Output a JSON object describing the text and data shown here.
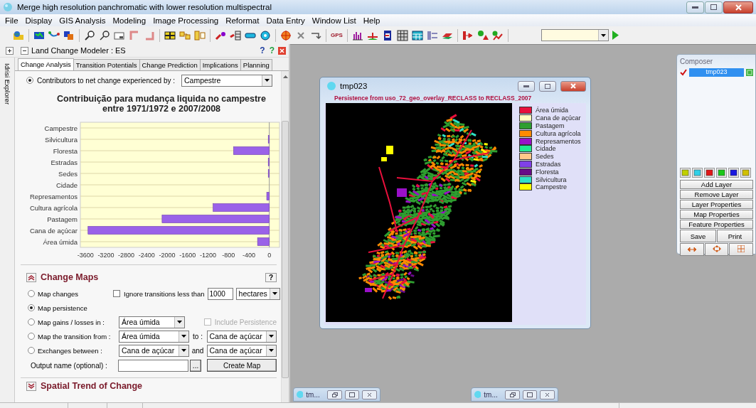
{
  "window": {
    "title": "Merge high resolution panchromatic with lower resolution multispectral"
  },
  "menu": [
    "File",
    "Display",
    "GIS Analysis",
    "Modeling",
    "Image Processing",
    "Reformat",
    "Data Entry",
    "Window List",
    "Help"
  ],
  "toolbar": {
    "gps_label": "GPS"
  },
  "lcm_panel": {
    "title": "Land Change Modeler : ES",
    "help_buttons": [
      "?",
      "?"
    ],
    "explorer_tab": "Idrisi Explorer",
    "tabs": [
      {
        "label": "Change Analysis",
        "selected": true
      },
      {
        "label": "Transition Potentials",
        "selected": false
      },
      {
        "label": "Change Prediction",
        "selected": false
      },
      {
        "label": "Implications",
        "selected": false
      },
      {
        "label": "Planning",
        "selected": false
      }
    ],
    "contributors": {
      "label": "Contributors to net change experienced by :",
      "selected": true,
      "value": "Campestre"
    },
    "chart_data": {
      "type": "bar",
      "orientation": "horizontal",
      "title": "Contribuição para mudança liquida no campestre\nentre 1971/1972 e 2007/2008",
      "categories": [
        "Campestre",
        "Silvicultura",
        "Floresta",
        "Estradas",
        "Sedes",
        "Cidade",
        "Represamentos",
        "Cultura agrícola",
        "Pastagem",
        "Cana de açúcar",
        "Área úmida"
      ],
      "values": [
        0,
        -20,
        -700,
        -20,
        -20,
        0,
        -50,
        -1100,
        -2100,
        -3550,
        -230
      ],
      "xlim": [
        -3700,
        200
      ],
      "xticks": [
        -3600,
        -3200,
        -2800,
        -2400,
        -2000,
        -1600,
        -1200,
        -800,
        -400,
        0
      ]
    },
    "change_maps": {
      "title": "Change Maps",
      "expanded": true,
      "help": "?",
      "options": [
        {
          "kind": "threshold",
          "label": "Map changes",
          "selected": false,
          "checkbox": {
            "label": "Ignore transitions less than",
            "checked": false,
            "disabled": false
          },
          "value": "1000",
          "units": "hectares"
        },
        {
          "kind": "plain",
          "label": "Map persistence",
          "selected": true
        },
        {
          "kind": "gains",
          "label": "Map gains / losses in :",
          "selected": false,
          "value": "Área úmida",
          "checkbox": {
            "label": "Include Persistence",
            "checked": false,
            "disabled": true
          }
        },
        {
          "kind": "pair",
          "label": "Map the transition from :",
          "selected": false,
          "value": "Área úmida",
          "joiner": "to :",
          "value2": "Cana de açúcar"
        },
        {
          "kind": "pair",
          "label": "Exchanges between :",
          "selected": false,
          "value": "Cana de açúcar",
          "joiner": "and",
          "value2": "Cana de açúcar"
        }
      ],
      "output": {
        "label": "Output name (optional) :",
        "browse": "...",
        "button": "Create Map"
      }
    },
    "spatial_trend": {
      "title": "Spatial Trend of Change",
      "expanded": false
    }
  },
  "map_window": {
    "title": "tmp023",
    "subtitle": "Persistence from uso_72_geo_overlay_RECLASS to RECLASS_2007",
    "legend": [
      {
        "label": "Área úmida",
        "color": "#e8103c"
      },
      {
        "label": "Cana de açúcar",
        "color": "#ffffc0"
      },
      {
        "label": "Pastagem",
        "color": "#2e9e30"
      },
      {
        "label": "Cultura agrícola",
        "color": "#ff8a00"
      },
      {
        "label": "Represamentos",
        "color": "#9a10c8"
      },
      {
        "label": "Cidade",
        "color": "#20e890"
      },
      {
        "label": "Sedes",
        "color": "#ffc88a"
      },
      {
        "label": "Estradas",
        "color": "#8040e8"
      },
      {
        "label": "Floresta",
        "color": "#680a88"
      },
      {
        "label": "Silvicultura",
        "color": "#30e0c8"
      },
      {
        "label": "Campestre",
        "color": "#ffff00"
      }
    ]
  },
  "composer": {
    "title": "Composer",
    "layers": [
      {
        "name": "tmp023",
        "visible": true,
        "selected": true
      }
    ],
    "buttons": [
      "Add Layer",
      "Remove Layer",
      "Layer Properties",
      "Map Properties",
      "Feature Properties"
    ],
    "save": "Save",
    "print": "Print"
  },
  "minimized": [
    {
      "title": "tm..."
    },
    {
      "title": "tm..."
    }
  ]
}
